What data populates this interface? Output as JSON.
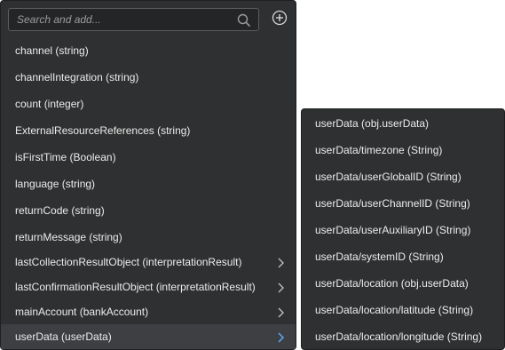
{
  "search": {
    "placeholder": "Search and add..."
  },
  "icons": {
    "search": "search-icon",
    "add": "plus-circle-icon",
    "submenu": "chevron-right-icon"
  },
  "colors": {
    "panel": "#2f3031",
    "selected_chevron": "#5aa0e6",
    "text": "#ececec"
  },
  "main_list": {
    "items": [
      {
        "label": "channel (string)"
      },
      {
        "label": "channelIntegration (string)"
      },
      {
        "label": "count (integer)"
      },
      {
        "label": "ExternalResourceReferences (string)"
      },
      {
        "label": "isFirstTime (Boolean)"
      },
      {
        "label": "language (string)"
      },
      {
        "label": "returnCode (string)"
      },
      {
        "label": "returnMessage (string)"
      },
      {
        "label": "lastCollectionResultObject (interpretationResult)"
      },
      {
        "label": "lastConfirmationResultObject (interpretationResult)"
      },
      {
        "label": "mainAccount (bankAccount)"
      },
      {
        "label": "userData (userData)"
      }
    ]
  },
  "submenu": {
    "items": [
      {
        "label": "userData (obj.userData)"
      },
      {
        "label": "userData/timezone (String)"
      },
      {
        "label": "userData/userGlobalID (String)"
      },
      {
        "label": "userData/userChannelID (String)"
      },
      {
        "label": "userData/userAuxiliaryID (String)"
      },
      {
        "label": "userData/systemID (String)"
      },
      {
        "label": "userData/location (obj.userData)"
      },
      {
        "label": "userData/location/latitude (String)"
      },
      {
        "label": "userData/location/longitude (String)"
      }
    ]
  }
}
